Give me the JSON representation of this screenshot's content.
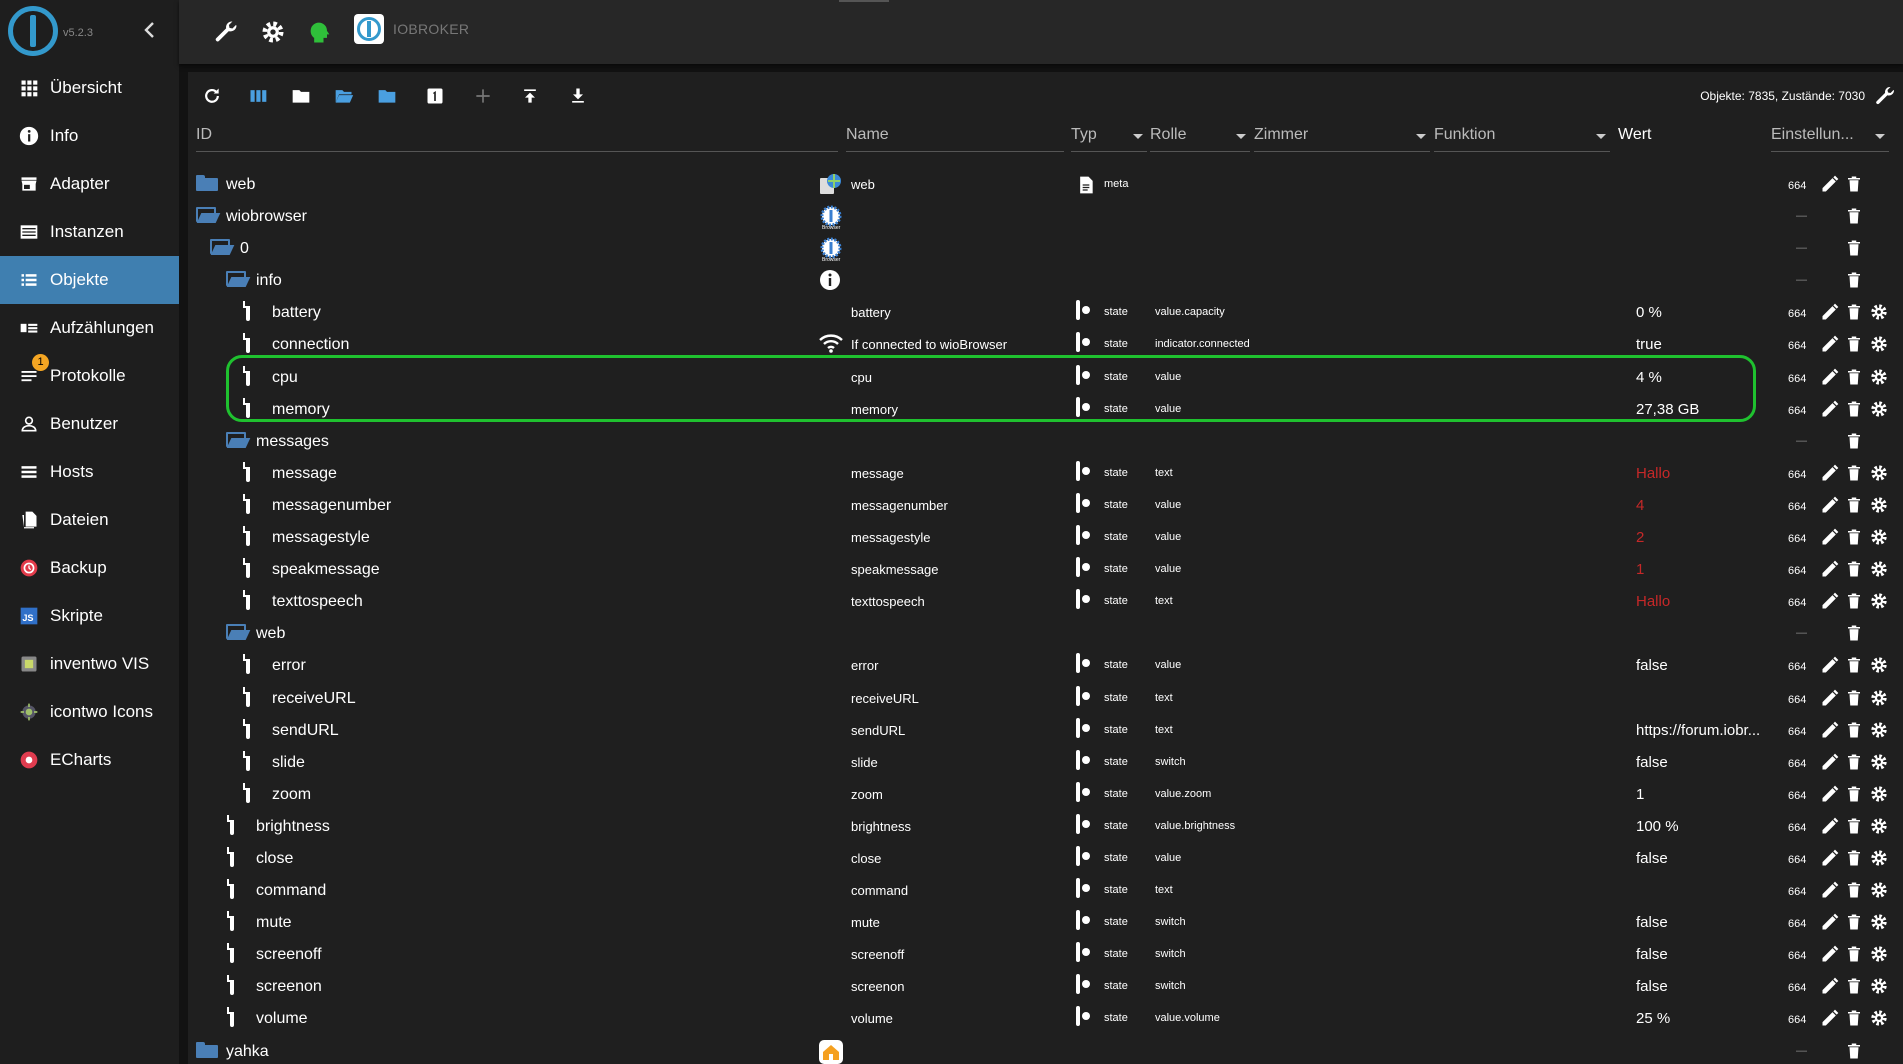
{
  "app": {
    "version": "v5.2.3",
    "brand": "IOBROKER"
  },
  "sidebar": {
    "items": [
      {
        "label": "Übersicht",
        "icon": "grid-icon"
      },
      {
        "label": "Info",
        "icon": "info-icon"
      },
      {
        "label": "Adapter",
        "icon": "store-icon"
      },
      {
        "label": "Instanzen",
        "icon": "instances-icon"
      },
      {
        "label": "Objekte",
        "icon": "list-icon",
        "active": true
      },
      {
        "label": "Aufzählungen",
        "icon": "enum-icon"
      },
      {
        "label": "Protokolle",
        "icon": "log-icon",
        "badge": "1"
      },
      {
        "label": "Benutzer",
        "icon": "user-icon"
      },
      {
        "label": "Hosts",
        "icon": "hosts-icon"
      },
      {
        "label": "Dateien",
        "icon": "files-icon"
      },
      {
        "label": "Backup",
        "icon": "backup-icon"
      },
      {
        "label": "Skripte",
        "icon": "js-icon"
      },
      {
        "label": "inventwo VIS",
        "icon": "inventwo-icon"
      },
      {
        "label": "icontwo Icons",
        "icon": "icontwo-icon"
      },
      {
        "label": "ECharts",
        "icon": "echarts-icon"
      }
    ]
  },
  "toolbar": {
    "stats": "Objekte: 7835, Zustände: 7030"
  },
  "header": {
    "id": "ID",
    "name": "Name",
    "type": "Typ",
    "role": "Rolle",
    "room": "Zimmer",
    "function": "Funktion",
    "value": "Wert",
    "settings": "Einstellun..."
  },
  "rows": [
    {
      "indent": 0,
      "icon": "folder",
      "id": "web",
      "nameIcon": "web",
      "name": "web",
      "type": "meta",
      "role": "",
      "value": "",
      "acl": "664",
      "actions": "full-noset"
    },
    {
      "indent": 0,
      "icon": "folder-open",
      "id": "wiobrowser",
      "nameIcon": "wio",
      "name": "",
      "type": "",
      "role": "",
      "value": "",
      "acl": "—",
      "actions": "del"
    },
    {
      "indent": 1,
      "icon": "folder-open",
      "id": "0",
      "nameIcon": "wio",
      "name": "",
      "type": "",
      "role": "",
      "value": "",
      "acl": "—",
      "actions": "del"
    },
    {
      "indent": 2,
      "icon": "folder-open",
      "id": "info",
      "nameIcon": "info",
      "name": "",
      "type": "",
      "role": "",
      "value": "",
      "acl": "—",
      "actions": "del"
    },
    {
      "indent": 3,
      "icon": "file",
      "id": "battery",
      "name": "battery",
      "type": "state",
      "role": "value.capacity",
      "value": "0 %",
      "acl": "664",
      "actions": "full"
    },
    {
      "indent": 3,
      "icon": "file",
      "id": "connection",
      "nameIcon": "wifi",
      "name": "If connected to wioBrowser",
      "type": "state",
      "role": "indicator.connected",
      "value": "true",
      "acl": "664",
      "actions": "full"
    },
    {
      "indent": 3,
      "icon": "file",
      "id": "cpu",
      "name": "cpu",
      "type": "state",
      "role": "value",
      "value": "4 %",
      "acl": "664",
      "actions": "full"
    },
    {
      "indent": 3,
      "icon": "file",
      "id": "memory",
      "name": "memory",
      "type": "state",
      "role": "value",
      "value": "27,38 GB",
      "acl": "664",
      "actions": "full"
    },
    {
      "indent": 2,
      "icon": "folder-open",
      "id": "messages",
      "name": "",
      "type": "",
      "role": "",
      "value": "",
      "acl": "—",
      "actions": "del"
    },
    {
      "indent": 3,
      "icon": "file",
      "id": "message",
      "name": "message",
      "type": "state",
      "role": "text",
      "value": "Hallo",
      "red": true,
      "acl": "664",
      "actions": "full"
    },
    {
      "indent": 3,
      "icon": "file",
      "id": "messagenumber",
      "name": "messagenumber",
      "type": "state",
      "role": "value",
      "value": "4",
      "red": true,
      "acl": "664",
      "actions": "full"
    },
    {
      "indent": 3,
      "icon": "file",
      "id": "messagestyle",
      "name": "messagestyle",
      "type": "state",
      "role": "value",
      "value": "2",
      "red": true,
      "acl": "664",
      "actions": "full"
    },
    {
      "indent": 3,
      "icon": "file",
      "id": "speakmessage",
      "name": "speakmessage",
      "type": "state",
      "role": "value",
      "value": "1",
      "red": true,
      "acl": "664",
      "actions": "full"
    },
    {
      "indent": 3,
      "icon": "file",
      "id": "texttospeech",
      "name": "texttospeech",
      "type": "state",
      "role": "text",
      "value": "Hallo",
      "red": true,
      "acl": "664",
      "actions": "full"
    },
    {
      "indent": 2,
      "icon": "folder-open",
      "id": "web",
      "name": "",
      "type": "",
      "role": "",
      "value": "",
      "acl": "—",
      "actions": "del"
    },
    {
      "indent": 3,
      "icon": "file",
      "id": "error",
      "name": "error",
      "type": "state",
      "role": "value",
      "value": "false",
      "acl": "664",
      "actions": "full"
    },
    {
      "indent": 3,
      "icon": "file",
      "id": "receiveURL",
      "name": "receiveURL",
      "type": "state",
      "role": "text",
      "value": "",
      "acl": "664",
      "actions": "full"
    },
    {
      "indent": 3,
      "icon": "file",
      "id": "sendURL",
      "name": "sendURL",
      "type": "state",
      "role": "text",
      "value": "https://forum.iobr...",
      "acl": "664",
      "actions": "full"
    },
    {
      "indent": 3,
      "icon": "file",
      "id": "slide",
      "name": "slide",
      "type": "state",
      "role": "switch",
      "value": "false",
      "acl": "664",
      "actions": "full"
    },
    {
      "indent": 3,
      "icon": "file",
      "id": "zoom",
      "name": "zoom",
      "type": "state",
      "role": "value.zoom",
      "value": "1",
      "acl": "664",
      "actions": "full"
    },
    {
      "indent": 2,
      "icon": "file",
      "id": "brightness",
      "name": "brightness",
      "type": "state",
      "role": "value.brightness",
      "value": "100 %",
      "acl": "664",
      "actions": "full"
    },
    {
      "indent": 2,
      "icon": "file",
      "id": "close",
      "name": "close",
      "type": "state",
      "role": "value",
      "value": "false",
      "acl": "664",
      "actions": "full"
    },
    {
      "indent": 2,
      "icon": "file",
      "id": "command",
      "name": "command",
      "type": "state",
      "role": "text",
      "value": "",
      "acl": "664",
      "actions": "full"
    },
    {
      "indent": 2,
      "icon": "file",
      "id": "mute",
      "name": "mute",
      "type": "state",
      "role": "switch",
      "value": "false",
      "acl": "664",
      "actions": "full"
    },
    {
      "indent": 2,
      "icon": "file",
      "id": "screenoff",
      "name": "screenoff",
      "type": "state",
      "role": "switch",
      "value": "false",
      "acl": "664",
      "actions": "full"
    },
    {
      "indent": 2,
      "icon": "file",
      "id": "screenon",
      "name": "screenon",
      "type": "state",
      "role": "switch",
      "value": "false",
      "acl": "664",
      "actions": "full"
    },
    {
      "indent": 2,
      "icon": "file",
      "id": "volume",
      "name": "volume",
      "type": "state",
      "role": "value.volume",
      "value": "25 %",
      "acl": "664",
      "actions": "full"
    },
    {
      "indent": 0,
      "icon": "folder",
      "id": "yahka",
      "nameIcon": "yahka",
      "name": "",
      "type": "",
      "role": "",
      "value": "",
      "acl": "—",
      "actions": "del"
    }
  ],
  "colors": {
    "accent": "#3f7fb0",
    "highlight": "#1fc12f",
    "red_value": "#c62828",
    "folder": "#4a7fb6"
  }
}
